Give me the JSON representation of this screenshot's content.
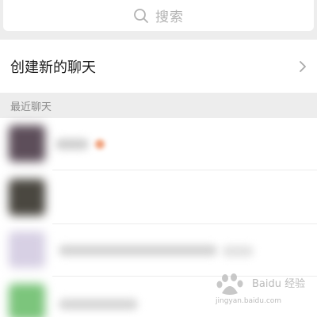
{
  "search": {
    "placeholder": "搜索",
    "icon": "search-icon"
  },
  "new_chat": {
    "label": "创建新的聊天",
    "icon": "chevron-right-icon"
  },
  "recent_section": {
    "title": "最近聊天"
  },
  "recent_chats": [
    {
      "avatar_color": "#5d4e5a",
      "name_blurred": true,
      "has_badge": true,
      "badge_color": "#f0a07a"
    },
    {
      "avatar_color": "#4a4740",
      "name_blurred": true,
      "has_badge": false
    },
    {
      "avatar_color": "#d7d0e4",
      "name_blurred": true,
      "has_badge": false
    },
    {
      "avatar_color": "#7cc57c",
      "name_blurred": true,
      "has_badge": false
    }
  ],
  "colors": {
    "background": "#ededed",
    "surface": "#ffffff",
    "text_primary": "#1a1a1a",
    "text_secondary": "#8a8a8a",
    "placeholder": "#b2b2b2"
  },
  "watermark": {
    "brand": "Baidu 经验",
    "url": "jingyan.baidu.com"
  }
}
